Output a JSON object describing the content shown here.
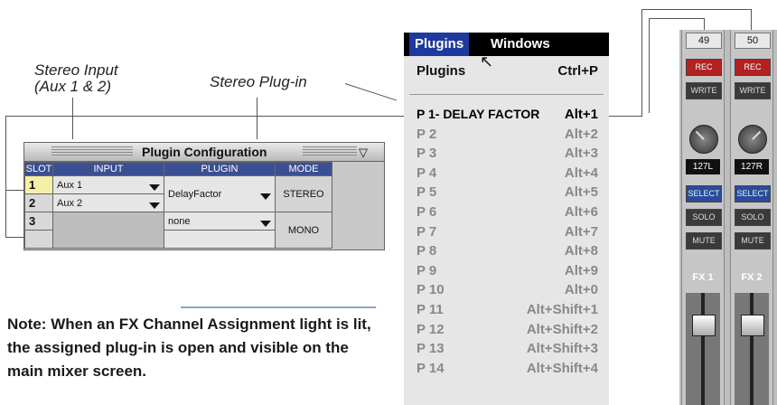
{
  "callouts": {
    "stereo_input": "Stereo Input",
    "stereo_input_sub": "(Aux 1 & 2)",
    "stereo_plugin": "Stereo Plug-in"
  },
  "plugin_config": {
    "title": "Plugin Configuration",
    "headers": {
      "slot": "SLOT",
      "input": "INPUT",
      "plugin": "PLUGIN",
      "mode": "MODE"
    },
    "rows": [
      {
        "slot": "1",
        "input": "Aux 1"
      },
      {
        "slot": "2",
        "input": "Aux 2"
      },
      {
        "slot": "3",
        "input": ""
      }
    ],
    "plugin_stereo": "DelayFactor",
    "plugin_slot3": "none",
    "mode_stereo": "STEREO",
    "mode_mono": "MONO"
  },
  "note": {
    "label": "Note:",
    "text": "When an FX Channel Assignment light is lit, the assigned plug-in is open and visible on the main mixer screen."
  },
  "menu": {
    "bar": [
      "Plugins",
      "Windows"
    ],
    "header": {
      "label": "Plugins",
      "shortcut": "Ctrl+P"
    },
    "items": [
      {
        "label": "P 1- DELAY FACTOR",
        "shortcut": "Alt+1"
      },
      {
        "label": "P 2",
        "shortcut": "Alt+2"
      },
      {
        "label": "P 3",
        "shortcut": "Alt+3"
      },
      {
        "label": "P 4",
        "shortcut": "Alt+4"
      },
      {
        "label": "P 5",
        "shortcut": "Alt+5"
      },
      {
        "label": "P 6",
        "shortcut": "Alt+6"
      },
      {
        "label": "P 7",
        "shortcut": "Alt+7"
      },
      {
        "label": "P 8",
        "shortcut": "Alt+8"
      },
      {
        "label": "P 9",
        "shortcut": "Alt+9"
      },
      {
        "label": "P 10",
        "shortcut": "Alt+0"
      },
      {
        "label": "P 11",
        "shortcut": "Alt+Shift+1"
      },
      {
        "label": "P 12",
        "shortcut": "Alt+Shift+2"
      },
      {
        "label": "P 13",
        "shortcut": "Alt+Shift+3"
      },
      {
        "label": "P 14",
        "shortcut": "Alt+Shift+4"
      }
    ]
  },
  "mixer": {
    "strips": [
      {
        "channel": "49",
        "rec": "REC",
        "write": "WRITE",
        "pan": "127L",
        "select": "SELECT",
        "solo": "SOLO",
        "mute": "MUTE",
        "fx": "FX 1"
      },
      {
        "channel": "50",
        "rec": "REC",
        "write": "WRITE",
        "pan": "127R",
        "select": "SELECT",
        "solo": "SOLO",
        "mute": "MUTE",
        "fx": "FX 2"
      }
    ]
  }
}
